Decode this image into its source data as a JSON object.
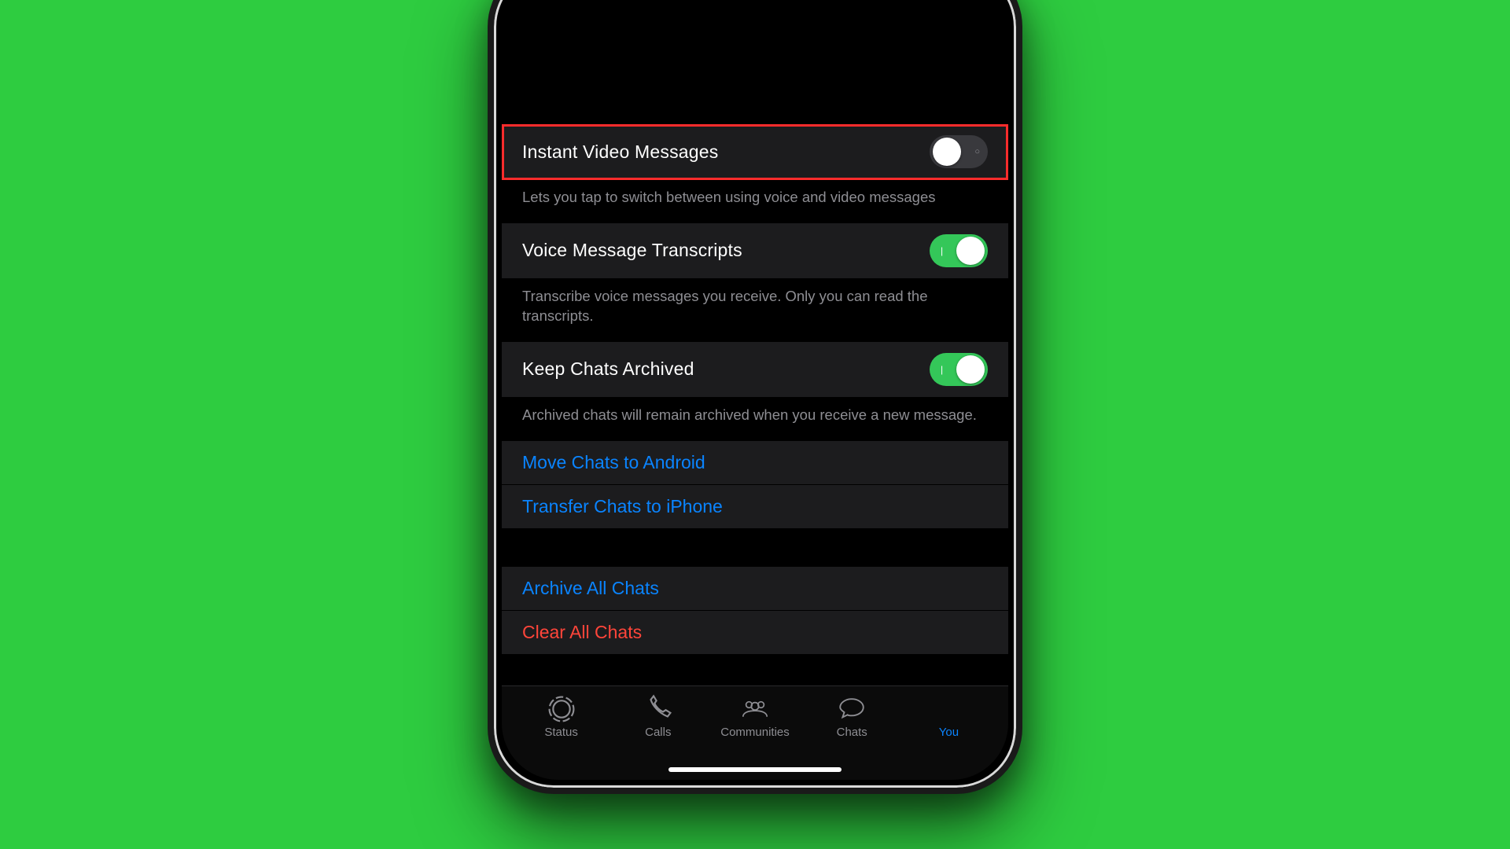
{
  "colors": {
    "accent": "#0a84ff",
    "toggleOn": "#34c759",
    "danger": "#ff453a"
  },
  "settings": {
    "instantVideo": {
      "label": "Instant Video Messages",
      "desc": "Lets you tap to switch between using voice and video messages",
      "on": false
    },
    "voiceTranscripts": {
      "label": "Voice Message Transcripts",
      "desc": "Transcribe voice messages you receive. Only you can read the transcripts.",
      "on": true
    },
    "keepArchived": {
      "label": "Keep Chats Archived",
      "desc": "Archived chats will remain archived when you receive a new message.",
      "on": true
    }
  },
  "links": {
    "moveAndroid": "Move Chats to Android",
    "transferIphone": "Transfer Chats to iPhone",
    "archiveAll": "Archive All Chats",
    "clearAll": "Clear All Chats"
  },
  "tabs": {
    "status": "Status",
    "calls": "Calls",
    "communities": "Communities",
    "chats": "Chats",
    "you": "You"
  }
}
